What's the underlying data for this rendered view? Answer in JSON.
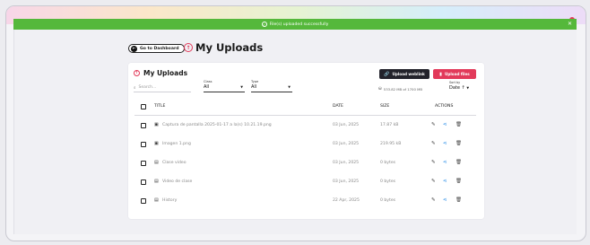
{
  "toast": {
    "message": "File(s) uploaded successfully"
  },
  "nav": {
    "dashboard_label": "Go to Dashboard"
  },
  "page": {
    "title": "My Uploads"
  },
  "card": {
    "title": "My Uploads",
    "search_placeholder": "Search...",
    "filters": [
      {
        "label": "Class",
        "value": "All"
      },
      {
        "label": "Type",
        "value": "All"
      }
    ],
    "buttons": {
      "weblink": "Upload weblink",
      "upload": "Upload files"
    },
    "storage": "533.82 MB of 1700 MB",
    "sort": {
      "label": "Sort by",
      "value": "Date"
    }
  },
  "table": {
    "headers": {
      "title": "TITLE",
      "date": "DATE",
      "size": "SIZE",
      "actions": "ACTIONS"
    },
    "rows": [
      {
        "icon": "image-file-icon",
        "title": "Captura de pantalla 2025-01-17 a la(s) 10.21.19.png",
        "date": "03 Jun, 2025",
        "size": "17.87 kB"
      },
      {
        "icon": "image-file-icon",
        "title": "Imagen 1.png",
        "date": "03 Jun, 2025",
        "size": "219.95 kB"
      },
      {
        "icon": "document-file-icon",
        "title": "Clase video",
        "date": "03 Jun, 2025",
        "size": "0 bytes"
      },
      {
        "icon": "document-file-icon",
        "title": "Video de clase",
        "date": "03 Jun, 2025",
        "size": "0 bytes"
      },
      {
        "icon": "document-file-icon",
        "title": "History",
        "date": "22 Apr, 2025",
        "size": "0 bytes"
      }
    ]
  },
  "colors": {
    "accent": "#e23a5a",
    "success": "#55b83b",
    "dark_button": "#23232b",
    "share": "#2a8de8"
  }
}
